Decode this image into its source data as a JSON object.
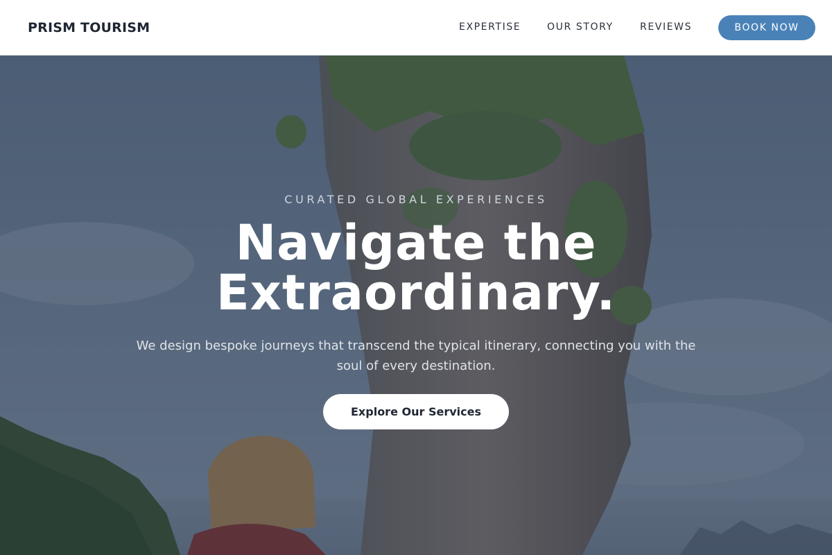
{
  "brand": {
    "name": "PRISM TOURISM"
  },
  "nav": {
    "links": [
      {
        "label": "EXPERTISE"
      },
      {
        "label": "OUR STORY"
      },
      {
        "label": "REVIEWS"
      }
    ],
    "cta_label": "BOOK NOW"
  },
  "hero": {
    "eyebrow": "CURATED GLOBAL EXPERIENCES",
    "headline_line1": "Navigate the",
    "headline_line2": "Extraordinary.",
    "subtext": "We design bespoke journeys that transcend the typical itinerary, connecting you with the soul of every destination.",
    "cta_label": "Explore Our Services"
  },
  "colors": {
    "accent": "#4a82b8",
    "brand_text": "#1f2633",
    "hero_overlay": "#1e2c42"
  }
}
